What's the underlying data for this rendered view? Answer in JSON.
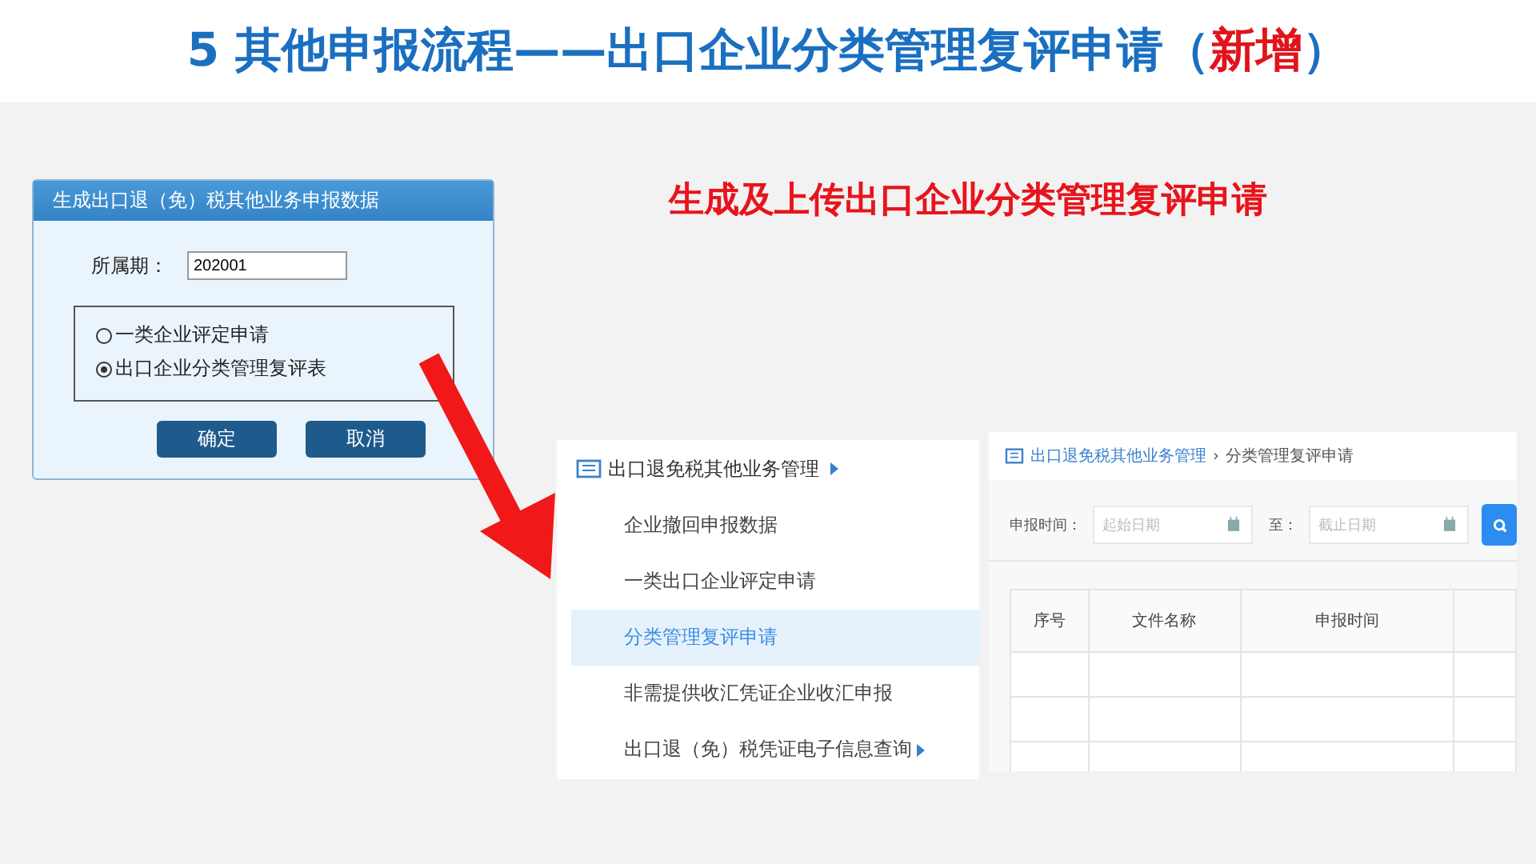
{
  "title": {
    "parts": [
      {
        "text": "5 其他申报流程——出口企业分类管理复评申请（",
        "kind": "plain"
      },
      {
        "text": "新增",
        "kind": "highlight"
      },
      {
        "text": "）",
        "kind": "plain"
      }
    ]
  },
  "dialog": {
    "title": "生成出口退（免）税其他业务申报数据",
    "period_label": "所属期：",
    "period_value": "202001",
    "options": [
      {
        "label": "一类企业评定申请",
        "selected": false
      },
      {
        "label": "出口企业分类管理复评表",
        "selected": true
      }
    ],
    "buttons": [
      "确定",
      "取消"
    ]
  },
  "subtitle": "生成及上传出口企业分类管理复评申请",
  "sidebar": {
    "header": "出口退免税其他业务管理",
    "items": [
      {
        "label": "企业撤回申报数据",
        "selected": false,
        "has_submenu": false
      },
      {
        "label": "一类出口企业评定申请",
        "selected": false,
        "has_submenu": false
      },
      {
        "label": "分类管理复评申请",
        "selected": true,
        "has_submenu": false
      },
      {
        "label": "非需提供收汇凭证企业收汇申报",
        "selected": false,
        "has_submenu": false
      },
      {
        "label": "出口退（免）税凭证电子信息查询",
        "selected": false,
        "has_submenu": true
      }
    ]
  },
  "content": {
    "breadcrumb": [
      {
        "text": "出口退免税其他业务管理",
        "kind": "link"
      },
      {
        "text": "›",
        "kind": "separator"
      },
      {
        "text": "分类管理复评申请",
        "kind": "current"
      }
    ],
    "filter": {
      "label": "申报时间：",
      "start": {
        "placeholder": "起始日期"
      },
      "to_label": "至：",
      "end": {
        "placeholder": "截止日期"
      }
    },
    "table": {
      "columns": [
        "序号",
        "文件名称",
        "申报时间"
      ]
    }
  }
}
